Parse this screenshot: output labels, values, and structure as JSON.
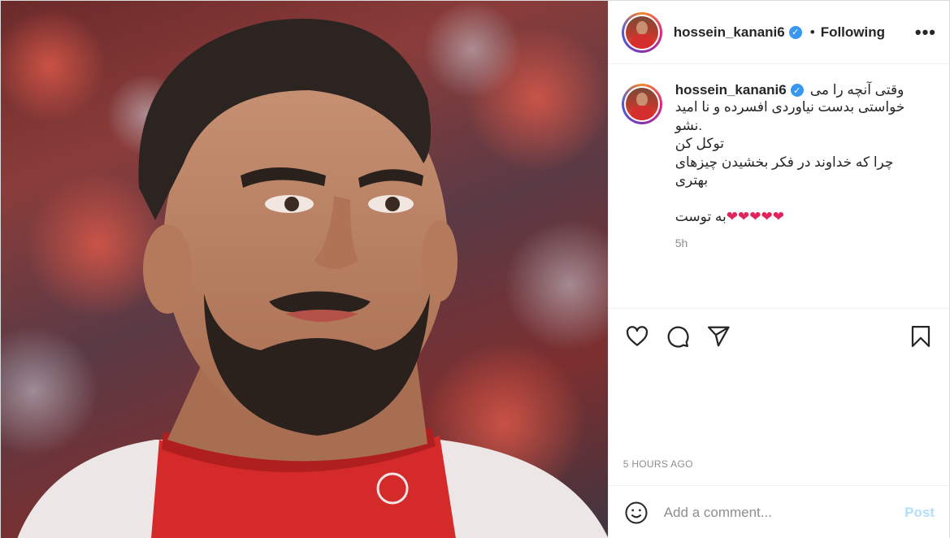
{
  "post": {
    "media": {
      "icon": "profile-photo",
      "colors": {
        "jersey": "#d32f2f",
        "skin": "#c48a6a",
        "hair": "#2b2421"
      }
    },
    "header": {
      "username": "hossein_kanani6",
      "verified_icon": "verified-badge-icon",
      "separator": "•",
      "follow_label": "Following",
      "more_label": "•••"
    },
    "caption": {
      "username": "hossein_kanani6",
      "line1": "وقتی آنچه را می",
      "line2": "خواستی بدست نیاوردی افسرده و نا امید",
      "line3": "نشو.",
      "line4": "توکل کن",
      "line5": "چرا که خداوند در فکر بخشیدن چیزهای بهتری",
      "line6_text": "به توست",
      "line6_hearts": "❤❤❤❤❤",
      "age": "5h"
    },
    "actions": {
      "like_icon": "heart-icon",
      "comment_icon": "comment-icon",
      "share_icon": "share-icon",
      "save_icon": "bookmark-icon"
    },
    "timestamp": "5 HOURS AGO",
    "comment_box": {
      "emoji_icon": "emoji-icon",
      "placeholder": "Add a comment...",
      "post_label": "Post"
    },
    "colors": {
      "link_blue": "#3897f0",
      "post_disabled": "#b2dffc",
      "muted": "#8e8e8e",
      "border": "#efefef"
    }
  }
}
